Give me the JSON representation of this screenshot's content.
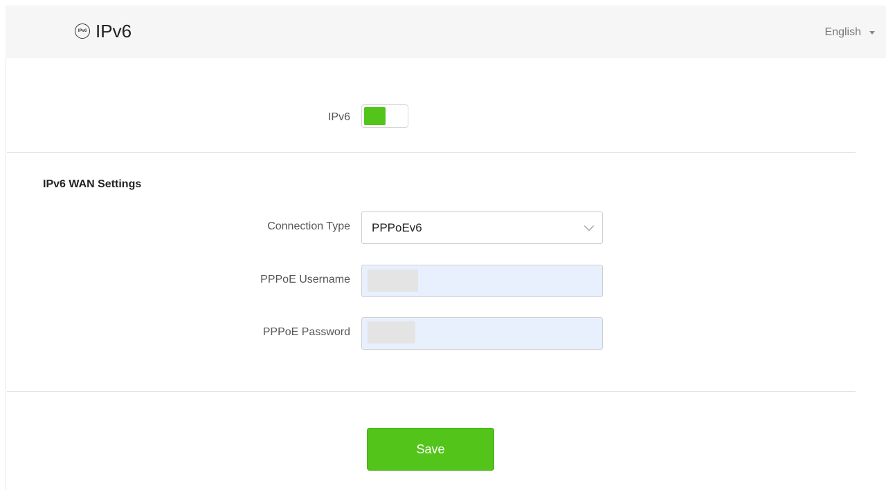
{
  "header": {
    "icon_text": "IPv6",
    "title": "IPv6",
    "language": "English"
  },
  "ipv6_toggle": {
    "label": "IPv6",
    "enabled": true,
    "color": "#52c41a"
  },
  "wan": {
    "section_title": "IPv6 WAN Settings",
    "connection_type": {
      "label": "Connection Type",
      "value": "PPPoEv6"
    },
    "username": {
      "label": "PPPoE Username",
      "value": ""
    },
    "password": {
      "label": "PPPoE Password",
      "value": ""
    }
  },
  "actions": {
    "save_label": "Save"
  }
}
